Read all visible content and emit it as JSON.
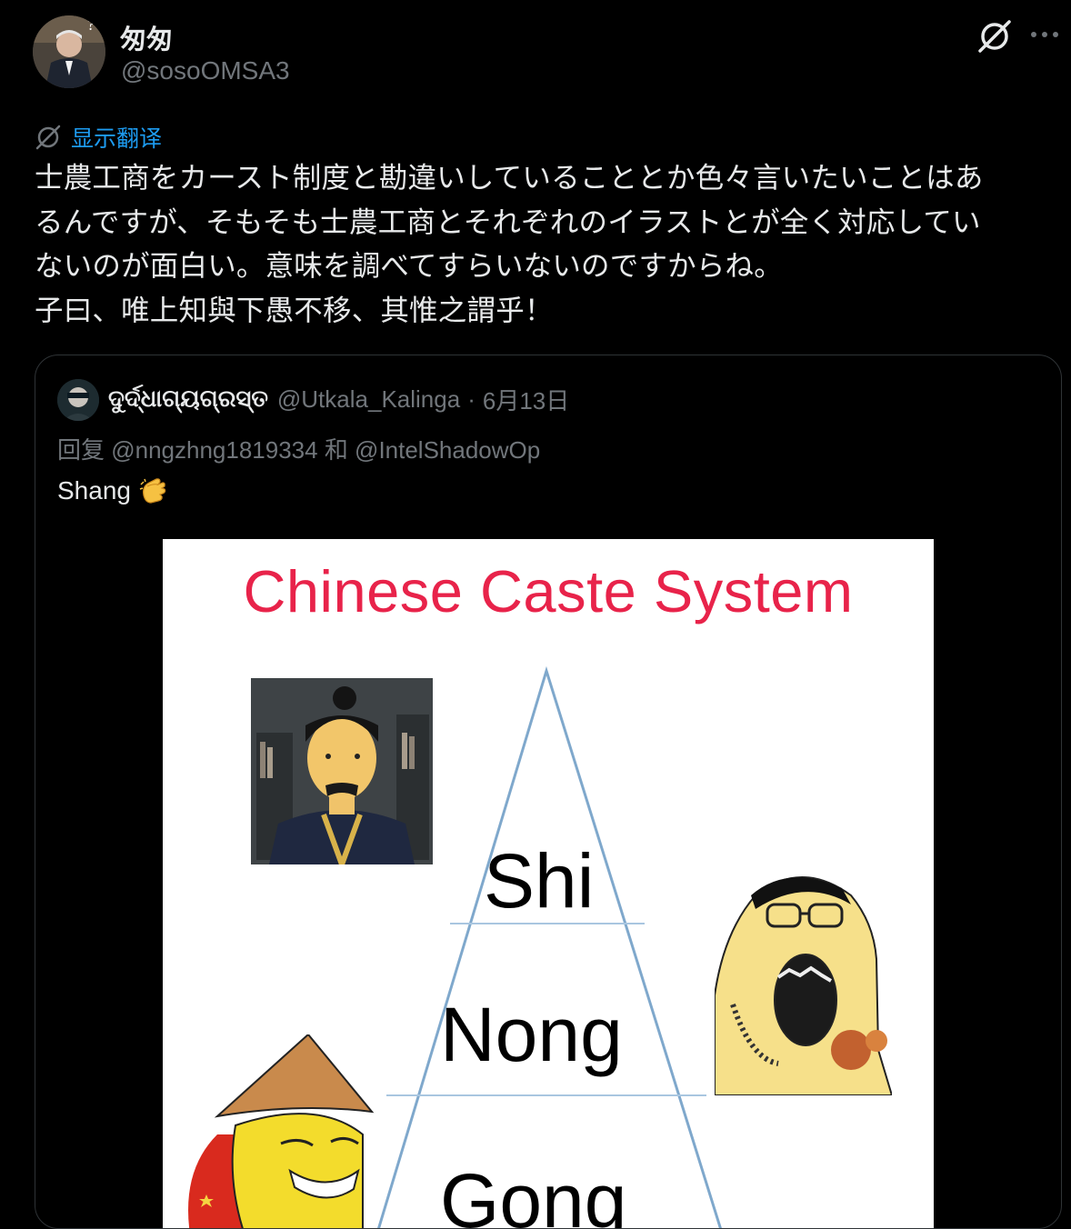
{
  "author": {
    "display_name": "匆匆",
    "handle": "@sosoOMSA3"
  },
  "translate": {
    "label": "显示翻译"
  },
  "tweet": {
    "lines": [
      "士農工商をカースト制度と勘違いしていることとか色々言いたいことはあ",
      "るんですが、そもそも士農工商とそれぞれのイラストとが全く対応してい",
      "ないのが面白い。意味を調べてすらいないのですからね。",
      "子曰、唯上知與下愚不移、其惟之謂乎！"
    ]
  },
  "quote": {
    "display_name": "ଦୁର୍ଦ୍ଧାଗ୍ୟଗ୍ରସ୍ତ",
    "handle": "@Utkala_Kalinga",
    "dot": "·",
    "date": "6月13日",
    "reply_to": "回复 @nngzhng1819334 和 @IntelShadowOp",
    "text": "Shang",
    "emoji_icon": "clapping-hands-icon",
    "media": {
      "title": "Chinese Caste System",
      "tiers": [
        "Shi",
        "Nong",
        "Gong"
      ]
    }
  },
  "icons": {
    "grok": "grok-icon",
    "more": "more-options-icon",
    "translate": "translate-icon"
  },
  "colors": {
    "background": "#000000",
    "text": "#e7e9ea",
    "secondary": "#71767b",
    "link": "#1d9bf0",
    "title_red": "#e8234a"
  }
}
